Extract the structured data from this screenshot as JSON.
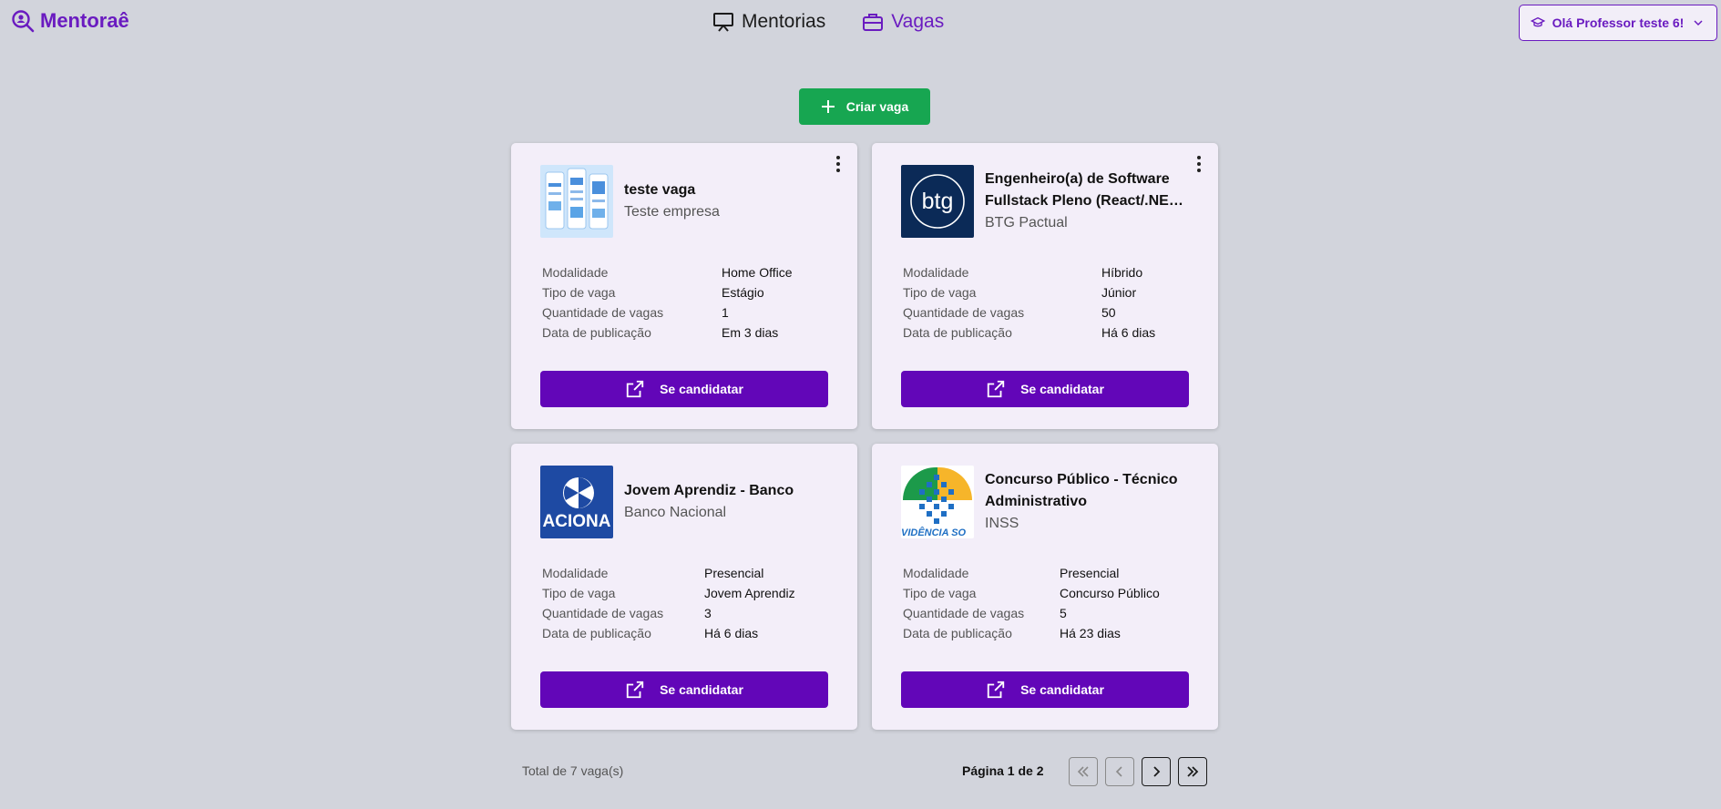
{
  "app": {
    "logo_text": "Mentoraê"
  },
  "nav": {
    "mentorias_label": "Mentorias",
    "vagas_label": "Vagas"
  },
  "user": {
    "greeting": "Olá Professor teste 6!"
  },
  "actions": {
    "create_label": "Criar vaga"
  },
  "labels": {
    "modalidade": "Modalidade",
    "tipo": "Tipo de vaga",
    "quantidade": "Quantidade de vagas",
    "data": "Data de publicação",
    "apply": "Se candidatar"
  },
  "jobs": [
    {
      "title": "teste vaga",
      "company": "Teste empresa",
      "modalidade": "Home Office",
      "tipo": "Estágio",
      "quantidade": "1",
      "data": "Em 3 dias"
    },
    {
      "title": "Engenheiro(a) de Software Fullstack Pleno (React/.NET) Banco BTG",
      "company": "BTG Pactual",
      "modalidade": "Híbrido",
      "tipo": "Júnior",
      "quantidade": "50",
      "data": "Há 6 dias",
      "logo_text": "btg"
    },
    {
      "title": "Jovem Aprendiz - Banco",
      "company": "Banco Nacional",
      "modalidade": "Presencial",
      "tipo": "Jovem Aprendiz",
      "quantidade": "3",
      "data": "Há 6 dias",
      "logo_text": "ACIONA"
    },
    {
      "title": "Concurso Público - Técnico Administrativo",
      "company": "INSS",
      "modalidade": "Presencial",
      "tipo": "Concurso Público",
      "quantidade": "5",
      "data": "Há 23 dias",
      "logo_text": "VIDÊNCIA SO"
    }
  ],
  "footer": {
    "total": "Total de 7 vaga(s)",
    "page_info": "Página 1 de 2"
  },
  "colors": {
    "brand": "#6a1bc0",
    "apply": "#6206b8",
    "create": "#17a651",
    "background": "#d2d4dc",
    "card": "#f3eef9"
  }
}
